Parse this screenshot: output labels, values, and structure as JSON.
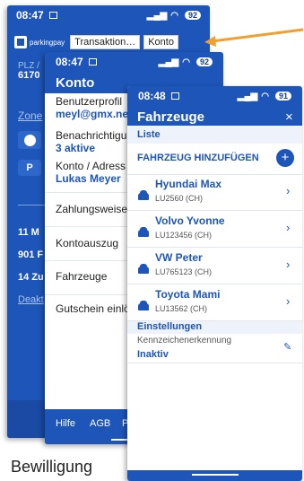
{
  "phone1": {
    "status": {
      "time": "08:47",
      "battery": "92"
    },
    "toolbar": {
      "brand": "parkingpay",
      "tab1": "Transaktion…",
      "tab2": "Konto"
    },
    "plz_label": "PLZ /",
    "plz_value": "6170",
    "zone_label": "Zone",
    "lines": [
      "11 M",
      "901 F",
      "14 Zu"
    ],
    "deakt": "Deakt"
  },
  "phone2": {
    "status": {
      "time": "08:47",
      "battery": "92"
    },
    "header": "Konto",
    "items": [
      {
        "title": "Benutzerprofil",
        "value": "meyl@gmx.net"
      },
      {
        "title": "Benachrichtigu",
        "value": "3 aktive"
      },
      {
        "title": "Konto / Adress",
        "value": "Lukas Meyer"
      },
      {
        "title": "Zahlungsweise",
        "value": ""
      },
      {
        "title": "Kontoauszug",
        "value": ""
      },
      {
        "title": "Fahrzeuge",
        "value": ""
      },
      {
        "title": "Gutschein einlö",
        "value": ""
      }
    ],
    "footer": {
      "help": "Hilfe",
      "agb": "AGB",
      "p": "P"
    }
  },
  "phone3": {
    "status": {
      "time": "08:48",
      "battery": "91"
    },
    "header": "Fahrzeuge",
    "close": "×",
    "list_label": "Liste",
    "add_label": "FAHRZEUG HINZUFÜGEN",
    "add_symbol": "+",
    "vehicles": [
      {
        "name": "Hyundai Max",
        "plate": "LU2560 (CH)"
      },
      {
        "name": "Volvo Yvonne",
        "plate": "LU123456 (CH)"
      },
      {
        "name": "VW Peter",
        "plate": "LU765123 (CH)"
      },
      {
        "name": "Toyota Mami",
        "plate": "LU13562 (CH)"
      }
    ],
    "settings_label": "Einstellungen",
    "plate_recog_label": "Kennzeichenerkennung",
    "plate_recog_value": "Inaktiv"
  },
  "caption": "Bewilligung",
  "colors": {
    "brand_blue": "#1d55b8",
    "arrow": "#f0a030",
    "text_dark": "#222222"
  }
}
